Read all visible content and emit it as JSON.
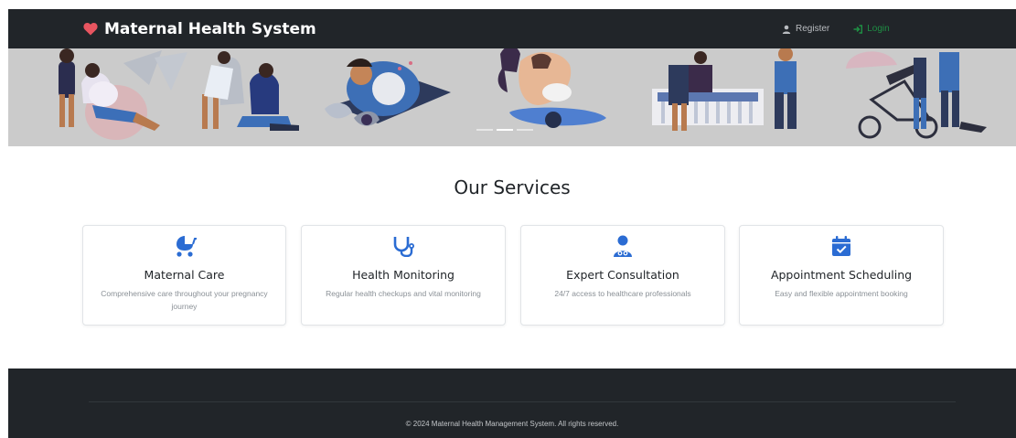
{
  "navbar": {
    "brand_label": "Maternal Health System",
    "links": [
      {
        "label": "Register",
        "icon": "user-icon"
      },
      {
        "label": "Login",
        "icon": "sign-in-icon"
      }
    ]
  },
  "hero": {
    "slides_count": 3,
    "active_slide": 2
  },
  "services": {
    "title": "Our Services",
    "cards": [
      {
        "icon": "baby-carriage-icon",
        "title": "Maternal Care",
        "text": "Comprehensive care throughout your pregnancy journey"
      },
      {
        "icon": "stethoscope-icon",
        "title": "Health Monitoring",
        "text": "Regular health checkups and vital monitoring"
      },
      {
        "icon": "doctor-icon",
        "title": "Expert Consultation",
        "text": "24/7 access to healthcare professionals"
      },
      {
        "icon": "calendar-check-icon",
        "title": "Appointment Scheduling",
        "text": "Easy and flexible appointment booking"
      }
    ]
  },
  "footer": {
    "copyright": "© 2024 Maternal Health Management System. All rights reserved."
  },
  "colors": {
    "navbar_bg": "#212529",
    "brand_heart": "#e85560",
    "accent_blue": "#2b6cd3",
    "login_green": "#1f8f44",
    "hero_bg": "#cbcbcb"
  }
}
